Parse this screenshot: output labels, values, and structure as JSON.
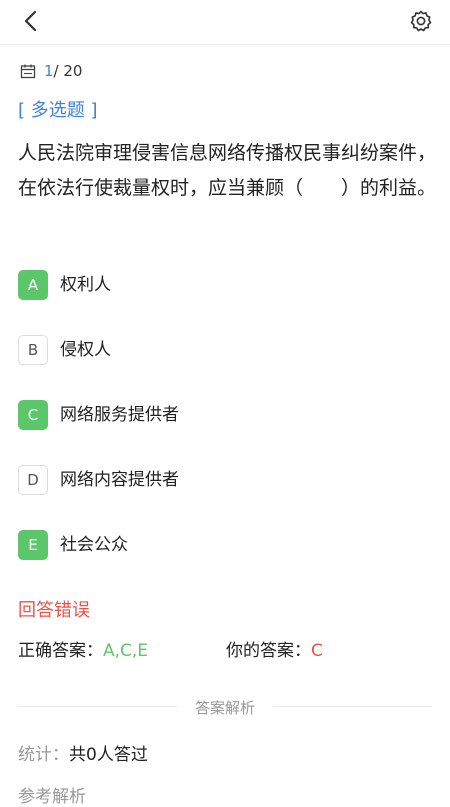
{
  "header": {
    "back_icon": "chevron-left-icon",
    "settings_icon": "gear-icon"
  },
  "progress": {
    "current": "1",
    "total": "/ 20",
    "icon": "calendar-icon"
  },
  "question": {
    "type_label": "[ 多选题 ]",
    "text": "人民法院审理侵害信息网络传播权民事纠纷案件，在依法行使裁量权时，应当兼顾（　　）的利益。"
  },
  "options": [
    {
      "letter": "A",
      "text": "权利人",
      "selected": true
    },
    {
      "letter": "B",
      "text": "侵权人",
      "selected": false
    },
    {
      "letter": "C",
      "text": "网络服务提供者",
      "selected": true
    },
    {
      "letter": "D",
      "text": "网络内容提供者",
      "selected": false
    },
    {
      "letter": "E",
      "text": "社会公众",
      "selected": true
    }
  ],
  "result": {
    "status": "回答错误",
    "correct_label": "正确答案：",
    "correct_value": "A,C,E",
    "your_label": "你的答案：",
    "your_value": "C"
  },
  "analysis": {
    "divider_label": "答案解析",
    "stats_label": "统计：",
    "stats_value": "共0人答过",
    "reference_label": "参考解析"
  },
  "colors": {
    "accent": "#3f83d8",
    "correct": "#5cc66a",
    "wrong": "#e8534a"
  }
}
